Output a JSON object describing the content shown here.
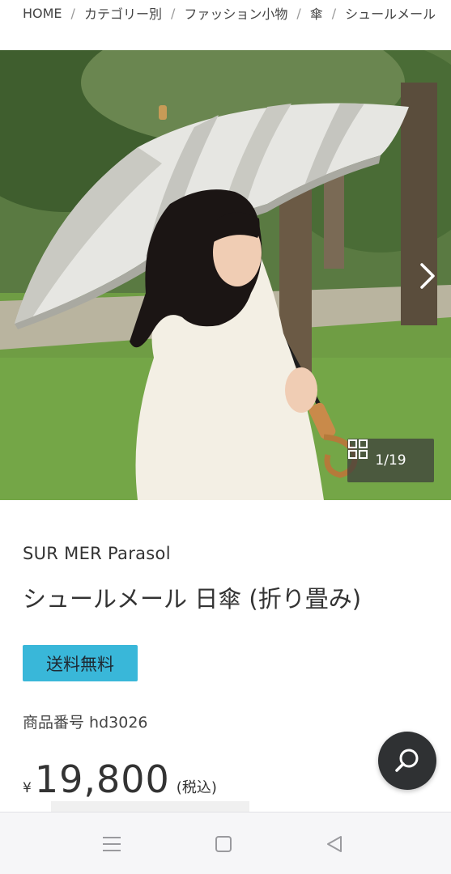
{
  "breadcrumb": {
    "items": [
      "HOME",
      "カテゴリー別",
      "ファッション小物",
      "傘",
      "シュールメール"
    ],
    "separator": "/"
  },
  "gallery": {
    "counter": "1/19",
    "grid_icon": "grid-icon",
    "next_icon": "chevron-right-icon"
  },
  "product": {
    "brand": "SUR MER Parasol",
    "title": "シュールメール 日傘 (折り畳み)",
    "badge": "送料無料",
    "sku": "商品番号 hd3026",
    "price": {
      "currency": "¥",
      "amount": "19,800",
      "tax_note": "(税込)"
    }
  },
  "search_fab": {
    "icon": "search-icon"
  },
  "system_nav": {
    "icons": [
      "menu-icon",
      "home-square-icon",
      "back-triangle-icon"
    ]
  },
  "colors": {
    "badge_bg": "#39b7d9",
    "fab_bg": "#2f3133",
    "text": "#333333"
  }
}
